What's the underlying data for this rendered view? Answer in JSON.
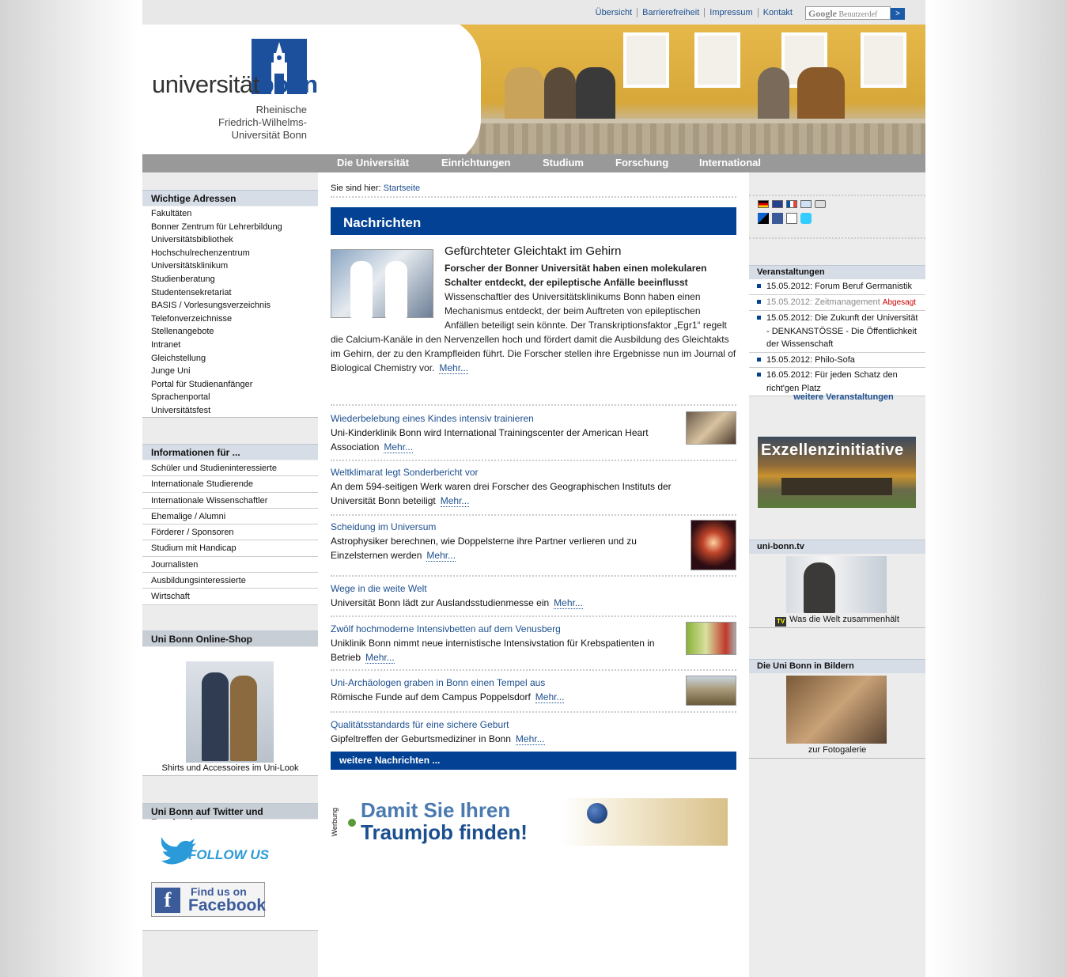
{
  "toplinks": [
    "Übersicht",
    "Barrierefreiheit",
    "Impressum",
    "Kontakt"
  ],
  "search": {
    "brand": "Google",
    "placeholder": "Benutzerdef",
    "button": ">"
  },
  "logo": {
    "text_main": "universität",
    "text_bold": "bonn",
    "subtitle": [
      "Rheinische",
      "Friedrich-Wilhelms-",
      "Universität Bonn"
    ]
  },
  "mainnav": [
    "Die Universität",
    "Einrichtungen",
    "Studium",
    "Forschung",
    "International"
  ],
  "left": {
    "adressen_title": "Wichtige Adressen",
    "adressen": [
      "Fakultäten",
      "Bonner Zentrum für Lehrerbildung",
      "Universitätsbibliothek",
      "Hochschulrechenzentrum",
      "Universitätsklinikum",
      "Studienberatung",
      "Studentensekretariat",
      "BASIS / Vorlesungsverzeichnis",
      "Telefonverzeichnisse",
      "Stellenangebote",
      "Intranet",
      "Gleichstellung",
      "Junge Uni",
      "Portal für Studienanfänger",
      "Sprachenportal",
      "Universitätsfest"
    ],
    "info_title": "Informationen für ...",
    "info": [
      "Schüler und Studieninteressierte",
      "Internationale Studierende",
      "Internationale Wissenschaftler",
      "Ehemalige / Alumni",
      "Förderer / Sponsoren",
      "Studium mit Handicap",
      "Journalisten",
      "Ausbildungsinteressierte",
      "Wirtschaft"
    ],
    "shop_title": "Uni Bonn Online-Shop",
    "shop_caption": "Shirts und Accessoires im Uni-Look",
    "social_title": "Uni Bonn auf Twitter und Facebook",
    "twitter_label": "FOLLOW US!",
    "fb_line1": "Find us on",
    "fb_line2": "Facebook",
    "fb_icon": "f"
  },
  "center": {
    "crumb_label": "Sie sind hier:",
    "crumb_link": "Startseite",
    "heading": "Nachrichten",
    "top": {
      "title": "Gefürchteter Gleichtakt im Gehirn",
      "lead": "Forscher der Bonner Universität haben einen molekularen Schalter entdeckt, der epileptische Anfälle beeinflusst",
      "body_indented": "Wissenschaftler des Universitätsklinikums Bonn haben einen Mechanismus entdeckt, der beim Auftreten von epileptischen Anfällen beteiligt sein könnte. Der Transkriptionsfaktor „Egr1“ regelt",
      "body_rest": "die Calcium-Kanäle in den Nervenzellen hoch und fördert damit die Ausbildung des Gleichtakts im Gehirn, der zu den Krampfleiden führt. Die Forscher stellen ihre Ergebnisse nun im Journal of Biological Chemistry vor.",
      "more": "Mehr..."
    },
    "items": [
      {
        "title": "Wiederbelebung eines Kindes intensiv trainieren",
        "desc": "Uni-Kinderklinik Bonn wird International Trainingscenter der American Heart Association",
        "more": "Mehr..."
      },
      {
        "title": "Weltklimarat legt Sonderbericht vor",
        "desc": "An dem 594-seitigen Werk waren drei Forscher des Geographischen Instituts der Universität Bonn beteiligt",
        "more": "Mehr..."
      },
      {
        "title": "Scheidung im Universum",
        "desc": "Astrophysiker berechnen, wie Doppelsterne ihre Partner verlieren und zu Einzelsternen werden",
        "more": "Mehr..."
      },
      {
        "title": "Wege in die weite Welt",
        "desc": "Universität Bonn lädt zur Auslandsstudienmesse ein",
        "more": "Mehr..."
      },
      {
        "title": "Zwölf hochmoderne Intensivbetten auf dem Venusberg",
        "desc": "Uniklinik Bonn nimmt neue internistische Intensivstation für Krebspatienten in Betrieb",
        "more": "Mehr..."
      },
      {
        "title": "Uni-Archäologen graben in Bonn einen Tempel aus",
        "desc": "Römische Funde auf dem Campus Poppelsdorf",
        "more": "Mehr..."
      },
      {
        "title": "Qualitätsstandards für eine sichere Geburt",
        "desc": "Gipfeltreffen der Geburtsmediziner in Bonn",
        "more": "Mehr..."
      }
    ],
    "more_news": "weitere Nachrichten ...",
    "ad_label": "Werbung",
    "ad_line1": "Damit Sie Ihren",
    "ad_line2": "Traumjob finden!"
  },
  "right": {
    "events_title": "Veranstaltungen",
    "events": [
      {
        "text": "15.05.2012: Forum Beruf Germanistik"
      },
      {
        "text": "15.05.2012: Zeitmanagement",
        "badge": "Abgesagt"
      },
      {
        "text": "15.05.2012: Die Zukunft der Universität - DENKANSTÖSSE - Die Öffentlichkeit der Wissenschaft"
      },
      {
        "text": "15.05.2012: Philo-Sofa"
      },
      {
        "text": "16.05.2012: Für jeden Schatz den richt'gen Platz"
      }
    ],
    "events_more": "weitere Veranstaltungen",
    "exzellenz": "Exzellenzinitiative",
    "tv_title": "uni-bonn.tv",
    "tv_icon": "TV",
    "tv_caption": "Was die Welt zusammenhält",
    "bilder_title": "Die Uni Bonn in Bildern",
    "bilder_caption": "zur Fotogalerie"
  },
  "colors": {
    "brand_blue": "#024193",
    "nav_grey": "#999999",
    "link": "#1c4f8f",
    "cancel_red": "#cc0000"
  }
}
